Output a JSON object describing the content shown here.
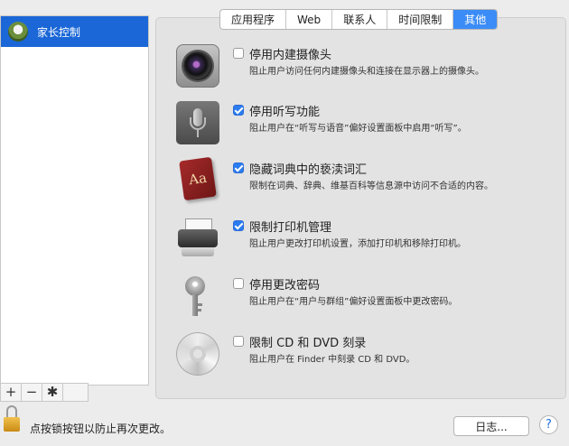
{
  "sidebar": {
    "user_name": "家长控制",
    "toolbar": {
      "add": "+",
      "remove": "−",
      "settings": "✱"
    }
  },
  "tabs": [
    {
      "label": "应用程序",
      "active": false
    },
    {
      "label": "Web",
      "active": false
    },
    {
      "label": "联系人",
      "active": false
    },
    {
      "label": "时间限制",
      "active": false
    },
    {
      "label": "其他",
      "active": true
    }
  ],
  "items": [
    {
      "icon": "camera-icon",
      "checked": false,
      "title": "停用内建摄像头",
      "desc": "阻止用户访问任何内建摄像头和连接在显示器上的摄像头。"
    },
    {
      "icon": "microphone-icon",
      "checked": true,
      "title": "停用听写功能",
      "desc": "阻止用户在“听写与语音”偏好设置面板中启用“听写”。"
    },
    {
      "icon": "dictionary-icon",
      "checked": true,
      "title": "隐藏词典中的亵渎词汇",
      "desc": "限制在词典、辞典、维基百科等信息源中访问不合适的内容。",
      "icon_text": "Aa"
    },
    {
      "icon": "printer-icon",
      "checked": true,
      "title": "限制打印机管理",
      "desc": "阻止用户更改打印机设置，添加打印机和移除打印机。"
    },
    {
      "icon": "key-icon",
      "checked": false,
      "title": "停用更改密码",
      "desc": "阻止用户在“用户与群组”偏好设置面板中更改密码。"
    },
    {
      "icon": "cd-icon",
      "checked": false,
      "title": "限制 CD 和 DVD 刻录",
      "desc": "阻止用户在 Finder 中刻录 CD 和 DVD。"
    }
  ],
  "footer": {
    "lock_text": "点按锁按钮以防止再次更改。",
    "log_button": "日志...",
    "help_button": "?"
  },
  "colors": {
    "accent": "#1b67d7",
    "tab_active": "#3b8cf7",
    "checkbox": "#2a7cf0"
  }
}
